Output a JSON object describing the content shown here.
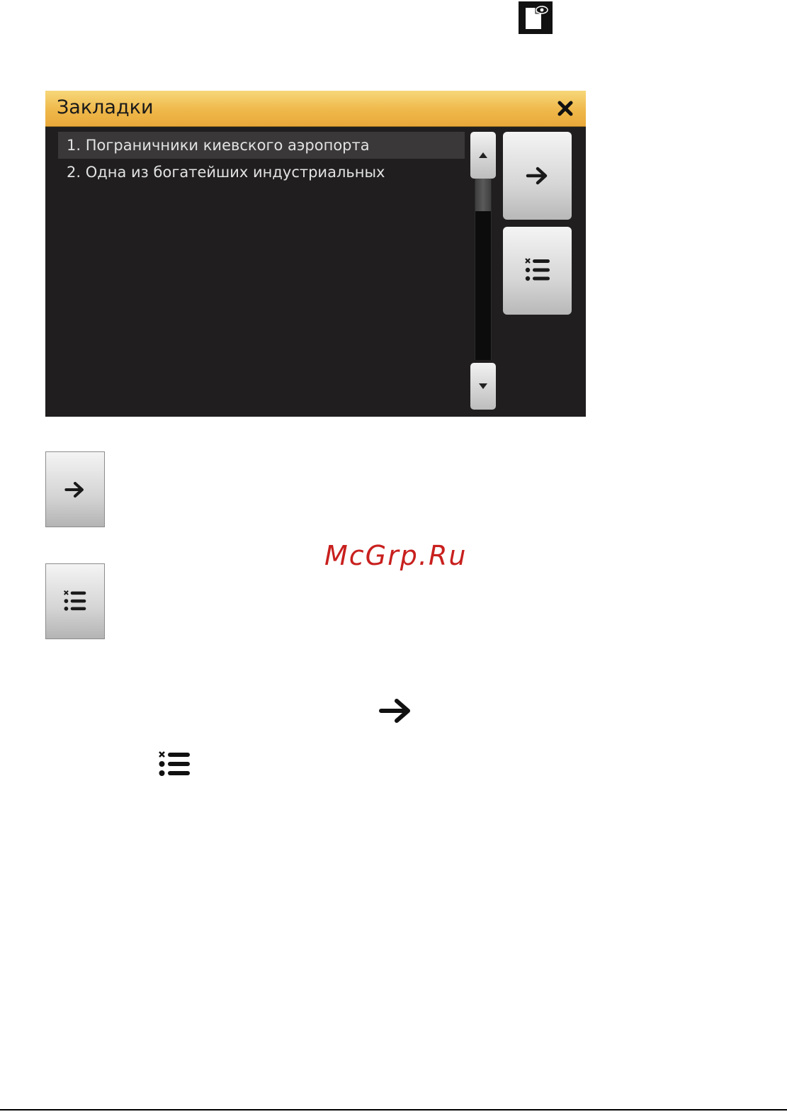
{
  "icons": {
    "doc_eye": "document-eye-icon",
    "close": "close-icon",
    "arrow": "arrow-right-icon",
    "clear_list": "clear-list-icon",
    "scroll_up": "caret-up-icon",
    "scroll_down": "caret-down-icon"
  },
  "dialog": {
    "title": "Закладки",
    "items": [
      "1. Пограничники киевского аэропорта",
      "2. Одна из богатейших индустриальных"
    ],
    "selected_index": 0
  },
  "watermark": "McGrp.Ru",
  "colors": {
    "header_top": "#f7d77a",
    "header_bottom": "#e9a93a",
    "dialog_bg": "#201e1f",
    "selected_row": "#3a3839",
    "watermark": "#c8201e"
  }
}
